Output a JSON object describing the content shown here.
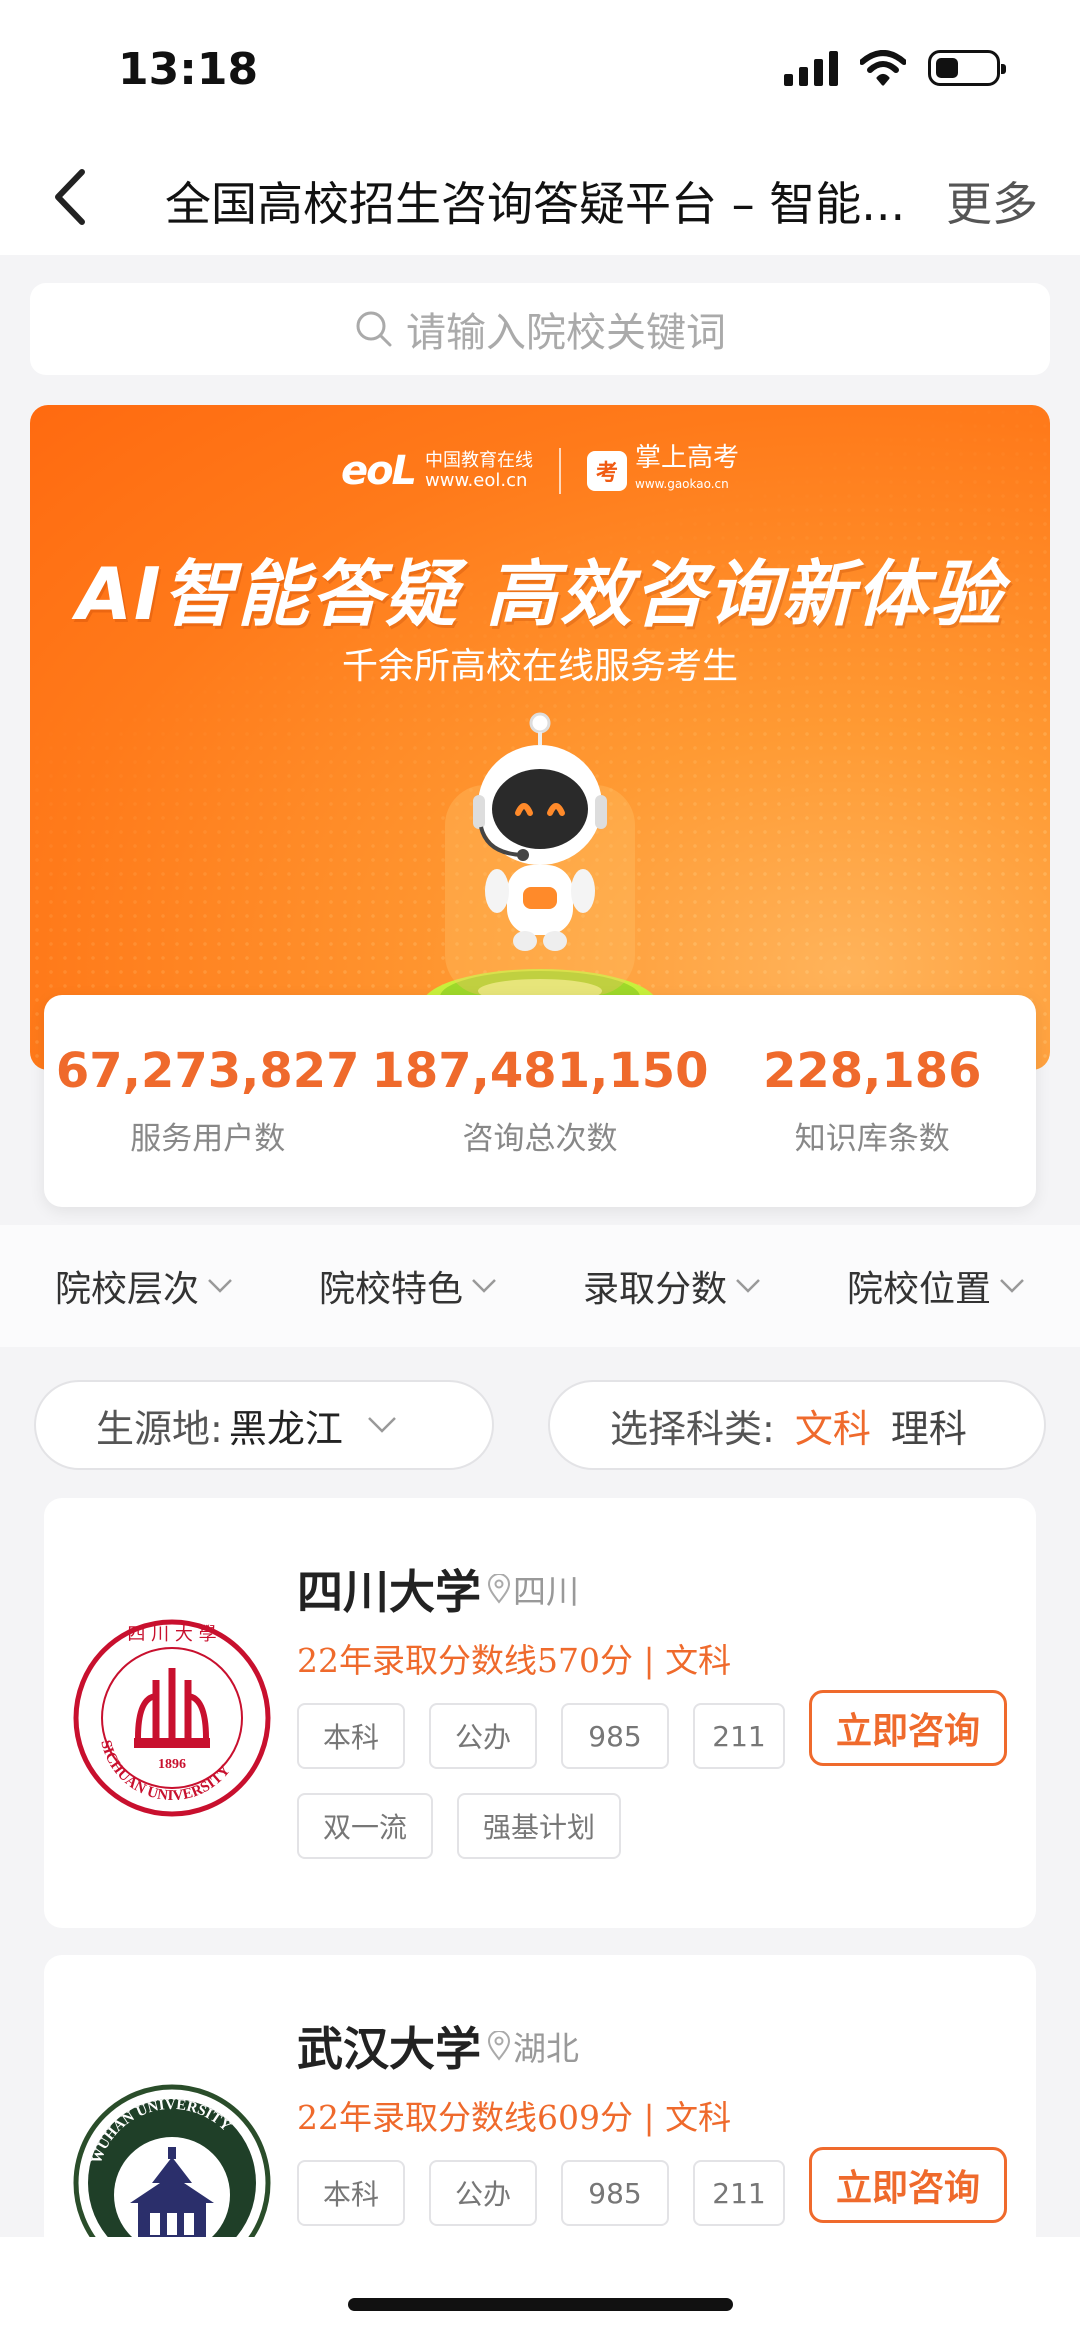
{
  "status_bar": {
    "time": "13:18"
  },
  "nav": {
    "title": "全国高校招生咨询答疑平台 – 智能...",
    "more": "更多"
  },
  "search": {
    "placeholder": "请输入院校关键词"
  },
  "banner": {
    "logo_left_text": "中国教育在线",
    "logo_left_url": "www.eol.cn",
    "logo_right_text": "掌上高考",
    "logo_right_url": "www.gaokao.cn",
    "headline": "AI智能答疑  高效咨询新体验",
    "subline": "千余所高校在线服务考生"
  },
  "stats": [
    {
      "value": "67,273,827",
      "label": "服务用户数"
    },
    {
      "value": "187,481,150",
      "label": "咨询总次数"
    },
    {
      "value": "228,186",
      "label": "知识库条数"
    }
  ],
  "filters": [
    {
      "label": "院校层次"
    },
    {
      "label": "院校特色"
    },
    {
      "label": "录取分数"
    },
    {
      "label": "院校位置"
    }
  ],
  "origin": {
    "label": "生源地:",
    "value": "黑龙江"
  },
  "subject": {
    "label": "选择科类:",
    "options": [
      "文科",
      "理科"
    ],
    "selected": "文科"
  },
  "universities": [
    {
      "name": "四川大学",
      "location": "四川",
      "score_line": "22年录取分数线570分 | 文科",
      "tags": [
        "本科",
        "公办",
        "985",
        "211",
        "双一流",
        "强基计划"
      ],
      "button": "立即咨询"
    },
    {
      "name": "武汉大学",
      "location": "湖北",
      "score_line": "22年录取分数线609分 | 文科",
      "tags": [
        "本科",
        "公办",
        "985",
        "211"
      ],
      "button": "立即咨询"
    }
  ],
  "colors": {
    "accent": "#ef6a2c",
    "background": "#f4f4f6"
  },
  "icons": [
    "back-icon",
    "search-icon",
    "chevron-down-icon",
    "location-pin-icon",
    "signal-icon",
    "wifi-icon",
    "battery-icon"
  ]
}
